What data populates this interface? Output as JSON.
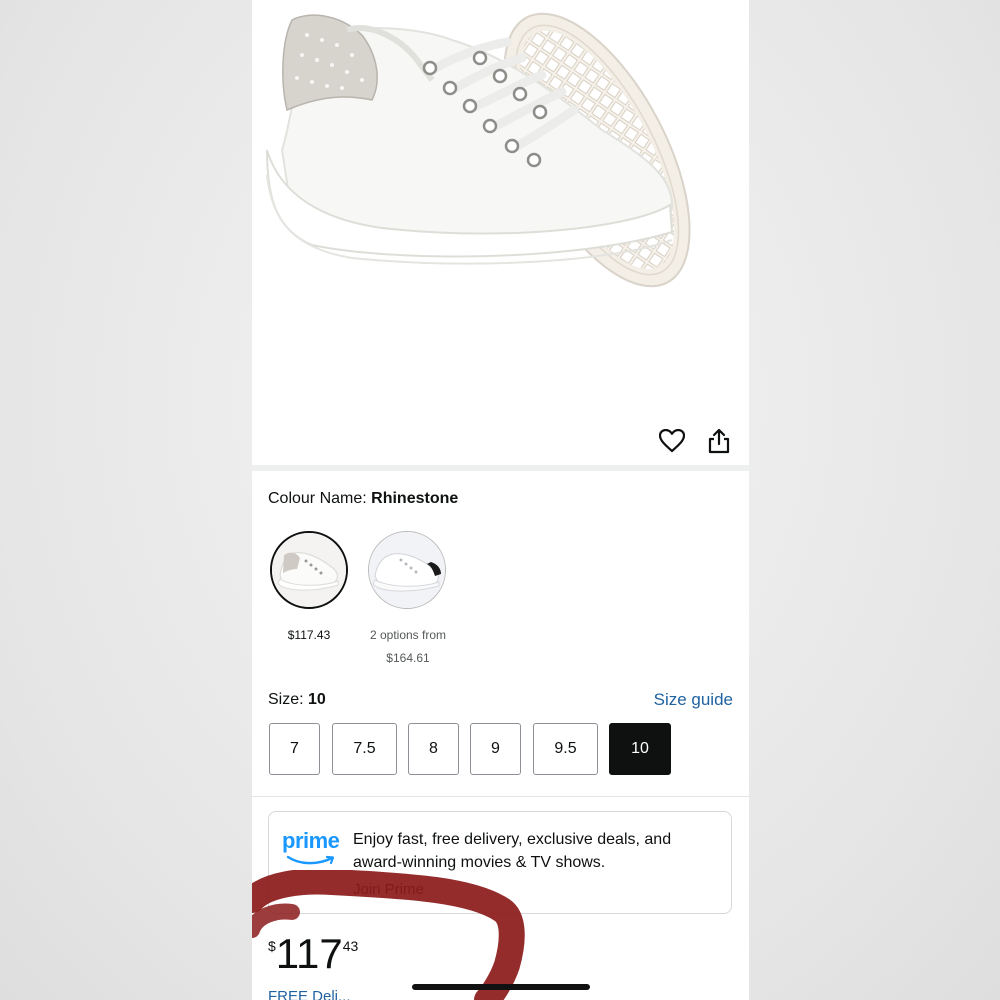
{
  "colors": {
    "link": "#2162a1",
    "text": "#0f1111",
    "prime_blue": "#1a98ff",
    "scribble": "#8b1a1a"
  },
  "product_image": {
    "icon": "white-sneaker-image"
  },
  "actions": {
    "wishlist_icon": "heart-icon",
    "share_icon": "share-icon"
  },
  "colour": {
    "label": "Colour Name: ",
    "selected": "Rhinestone",
    "options": [
      {
        "price": "$117.43"
      },
      {
        "line1": "2 options from",
        "line2": "$164.61"
      }
    ]
  },
  "size": {
    "label": "Size: ",
    "selected": "10",
    "guide": "Size guide",
    "options": [
      "7",
      "7.5",
      "8",
      "9",
      "9.5",
      "10"
    ]
  },
  "prime": {
    "logo": "prime",
    "text": "Enjoy fast, free delivery, exclusive deals, and award-winning movies & TV shows.",
    "join": "Join Prime"
  },
  "price": {
    "currency": "$",
    "whole": "117",
    "fraction": "43"
  },
  "delivery": {
    "text": "FREE Deli..."
  }
}
